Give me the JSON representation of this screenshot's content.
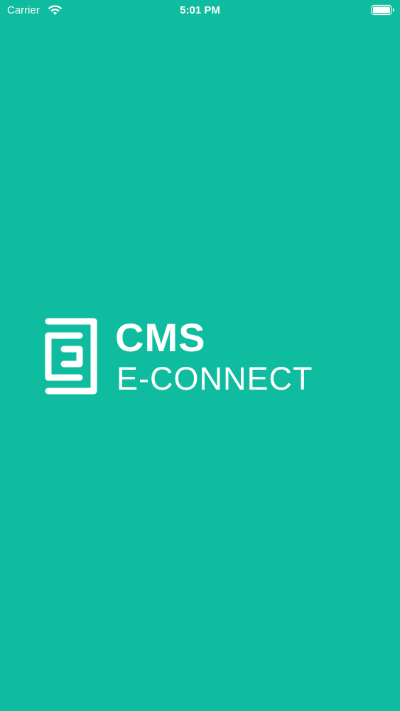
{
  "status_bar": {
    "carrier": "Carrier",
    "time": "5:01 PM",
    "wifi_icon": "wifi-icon",
    "battery_icon": "battery-full-icon"
  },
  "splash": {
    "logo_icon": "cms-e-connect-logo-icon",
    "brand_name": "CMS",
    "brand_subtitle": "E-CONNECT"
  },
  "colors": {
    "background": "#10bc9f",
    "foreground": "#ffffff"
  }
}
